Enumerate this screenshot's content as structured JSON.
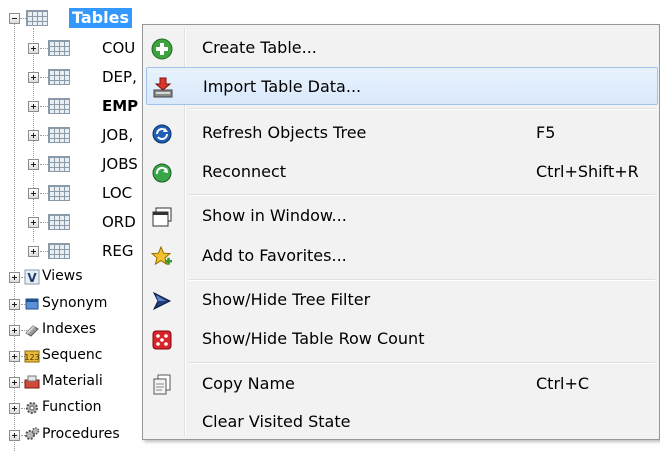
{
  "tree": {
    "root_label": "Tables",
    "table_nodes": [
      {
        "label": "COU",
        "bold": false
      },
      {
        "label": "DEP,",
        "bold": false
      },
      {
        "label": "EMP",
        "bold": true
      },
      {
        "label": "JOB,",
        "bold": false
      },
      {
        "label": "JOBS",
        "bold": false
      },
      {
        "label": "LOC",
        "bold": false
      },
      {
        "label": "ORD",
        "bold": false
      },
      {
        "label": "REG",
        "bold": false
      }
    ],
    "sibling_nodes": [
      {
        "label": "Views",
        "icon": "views-icon"
      },
      {
        "label": "Synonym",
        "icon": "synonyms-icon"
      },
      {
        "label": "Indexes",
        "icon": "indexes-icon"
      },
      {
        "label": "Sequenc",
        "icon": "sequences-icon"
      },
      {
        "label": "Materiali",
        "icon": "materialized-views-icon"
      },
      {
        "label": "Function",
        "icon": "functions-icon"
      },
      {
        "label": "Procedures",
        "icon": "procedures-icon"
      }
    ]
  },
  "menu": {
    "items": [
      {
        "label": "Create Table...",
        "shortcut": "",
        "icon": "create-table-icon"
      },
      {
        "label": "Import Table Data...",
        "shortcut": "",
        "icon": "import-table-data-icon"
      },
      {
        "label": "Refresh Objects Tree",
        "shortcut": "F5",
        "icon": "refresh-icon"
      },
      {
        "label": "Reconnect",
        "shortcut": "Ctrl+Shift+R",
        "icon": "reconnect-icon"
      },
      {
        "label": "Show in Window...",
        "shortcut": "",
        "icon": "window-icon"
      },
      {
        "label": "Add to Favorites...",
        "shortcut": "",
        "icon": "favorites-star-icon"
      },
      {
        "label": "Show/Hide Tree Filter",
        "shortcut": "",
        "icon": "tree-filter-icon"
      },
      {
        "label": "Show/Hide Table Row Count",
        "shortcut": "",
        "icon": "row-count-dice-icon"
      },
      {
        "label": "Copy Name",
        "shortcut": "Ctrl+C",
        "icon": "copy-name-icon"
      },
      {
        "label": "Clear Visited State",
        "shortcut": "",
        "icon": ""
      }
    ],
    "highlighted_index": 1
  },
  "colors": {
    "selection": "#3399ff",
    "menu_background": "#f2f2f2",
    "highlight_border": "#9fc3ec"
  }
}
